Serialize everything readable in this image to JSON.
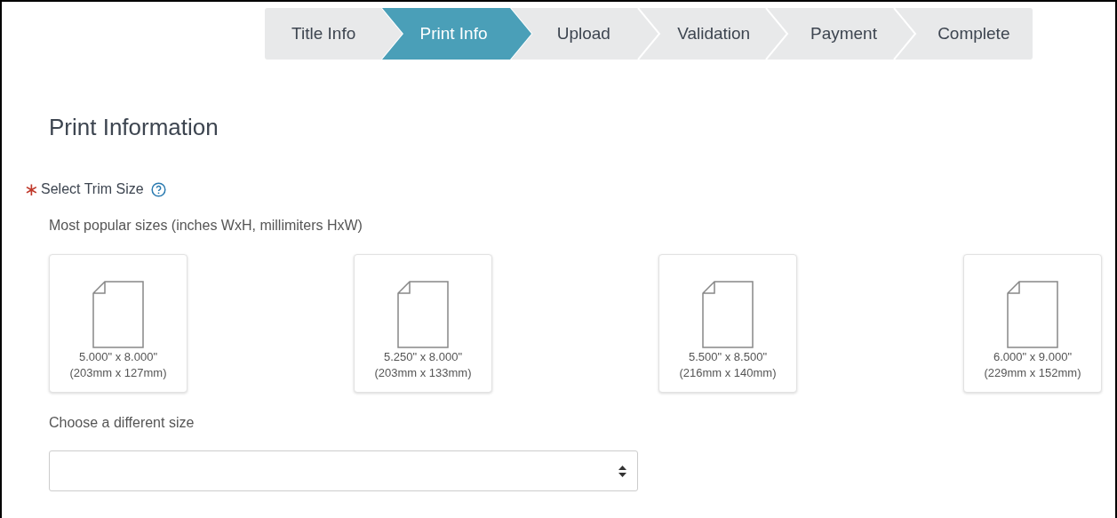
{
  "steps": [
    {
      "label": "Title Info",
      "selected": false
    },
    {
      "label": "Print Info",
      "selected": true
    },
    {
      "label": "Upload",
      "selected": false
    },
    {
      "label": "Validation",
      "selected": false
    },
    {
      "label": "Payment",
      "selected": false
    },
    {
      "label": "Complete",
      "selected": false
    }
  ],
  "heading": "Print Information",
  "trim_size": {
    "required_mark": "∗",
    "label": "Select Trim Size",
    "hint": "Most popular sizes (inches WxH, millimiters HxW)",
    "sizes": [
      {
        "inches": "5.000\" x 8.000\"",
        "mm": "(203mm x 127mm)"
      },
      {
        "inches": "5.250\" x 8.000\"",
        "mm": "(203mm x 133mm)"
      },
      {
        "inches": "5.500\" x 8.500\"",
        "mm": "(216mm x 140mm)"
      },
      {
        "inches": "6.000\" x 9.000\"",
        "mm": "(229mm x 152mm)"
      }
    ],
    "other_label": "Choose a different size"
  }
}
